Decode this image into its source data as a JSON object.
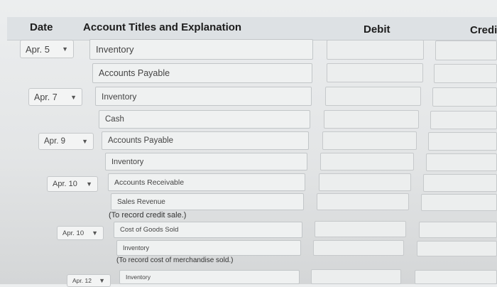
{
  "header": {
    "date": "Date",
    "account": "Account Titles and Explanation",
    "debit": "Debit",
    "credit": "Credit"
  },
  "entries": [
    {
      "date": "Apr. 5",
      "lines": [
        "Inventory",
        "Accounts Payable"
      ]
    },
    {
      "date": "Apr. 7",
      "lines": [
        "Inventory",
        "Cash"
      ]
    },
    {
      "date": "Apr. 9",
      "lines": [
        "Accounts Payable",
        "Inventory"
      ]
    },
    {
      "date": "Apr. 10",
      "lines": [
        "Accounts Receivable",
        "Sales Revenue"
      ],
      "note": "(To record credit sale.)"
    },
    {
      "date": "Apr. 10",
      "lines": [
        "Cost of Goods Sold",
        "Inventory"
      ],
      "note": "(To record cost of merchandise sold.)"
    },
    {
      "date": "Apr. 12",
      "lines": [
        "Inventory"
      ]
    }
  ]
}
